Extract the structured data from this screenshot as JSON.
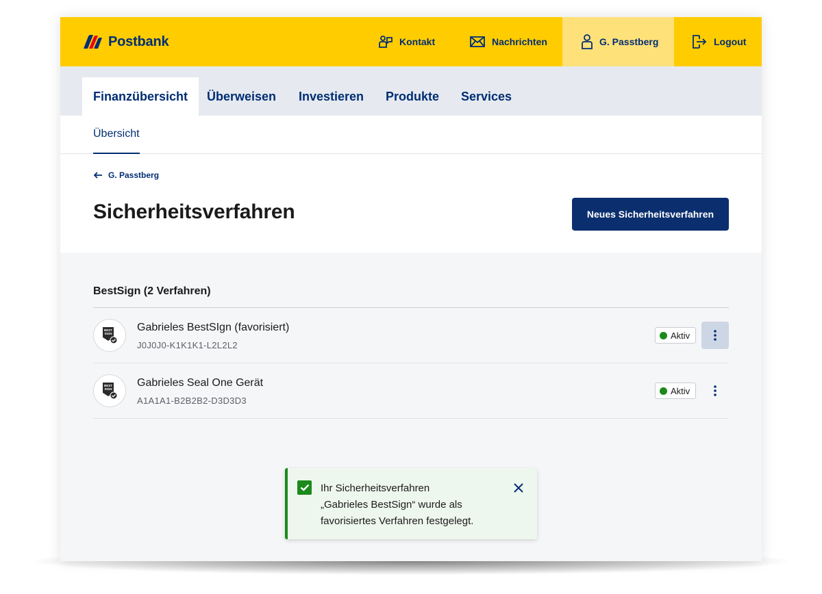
{
  "brand": {
    "name": "Postbank"
  },
  "header": {
    "kontakt": "Kontakt",
    "nachrichten": "Nachrichten",
    "user": "G. Passtberg",
    "logout": "Logout"
  },
  "tabs": [
    {
      "label": "Finanzübersicht",
      "active": true
    },
    {
      "label": "Überweisen"
    },
    {
      "label": "Investieren"
    },
    {
      "label": "Produkte"
    },
    {
      "label": "Services"
    }
  ],
  "subnav": {
    "active": "Übersicht"
  },
  "page": {
    "back_label": "G. Passtberg",
    "title": "Sicherheitsverfahren",
    "new_button": "Neues Sicherheitsverfahren"
  },
  "section": {
    "title": "BestSign (2 Verfahren)",
    "items": [
      {
        "name": "Gabrieles BestSIgn (favorisiert)",
        "id": "J0J0J0-K1K1K1-L2L2L2",
        "status": "Aktiv"
      },
      {
        "name": "Gabrieles Seal One Gerät",
        "id": "A1A1A1-B2B2B2-D3D3D3",
        "status": "Aktiv"
      }
    ]
  },
  "toast": {
    "line1": "Ihr Sicherheitsverfahren",
    "line2": "„Gabrieles BestSign“ wurde als",
    "line3": "favorisiertes Verfahren festgelegt."
  },
  "icons": {
    "logo": "postbank-logo-icon",
    "kontakt": "people-icon",
    "nachrichten": "envelope-icon",
    "user": "user-icon",
    "logout": "logout-icon",
    "back": "arrow-left-icon",
    "device": "bestsign-badge-icon",
    "menu": "kebab-menu-icon",
    "success": "checkbox-checked-icon",
    "close": "close-icon"
  },
  "colors": {
    "brand_yellow": "#ffcc00",
    "brand_blue": "#002d73",
    "success_green": "#1b8a1b"
  }
}
